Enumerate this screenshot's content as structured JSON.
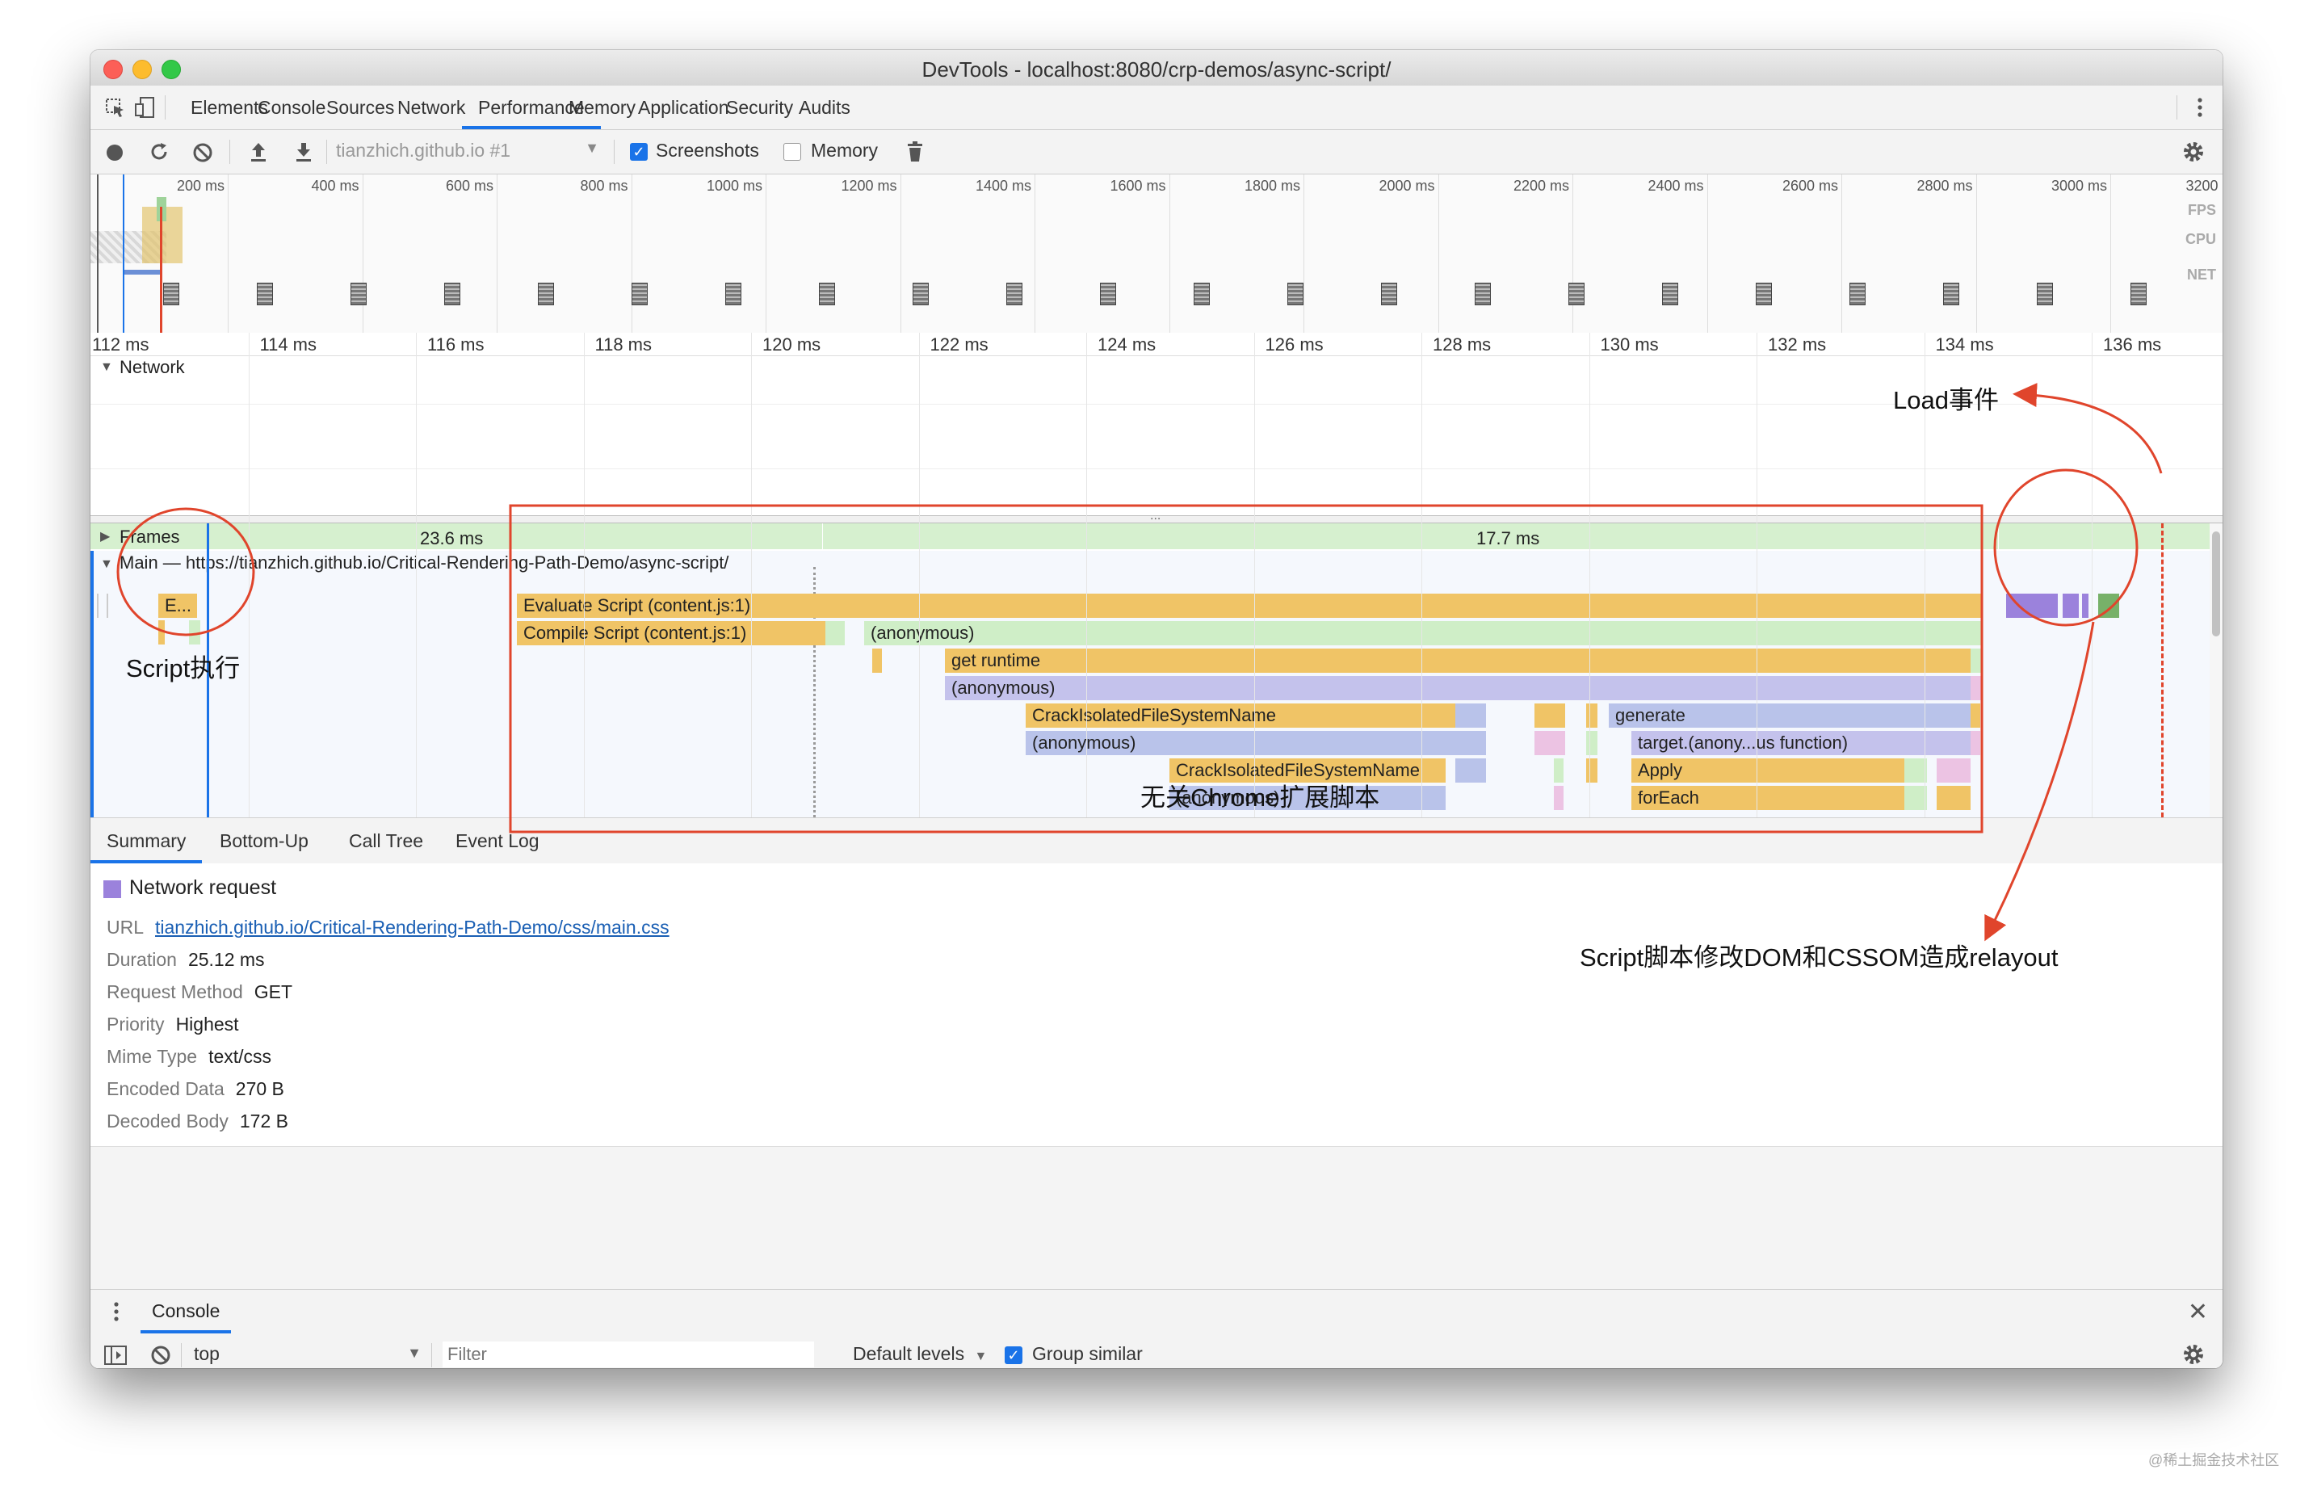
{
  "window": {
    "title": "DevTools - localhost:8080/crp-demos/async-script/"
  },
  "tabs": [
    "Elements",
    "Console",
    "Sources",
    "Network",
    "Performance",
    "Memory",
    "Application",
    "Security",
    "Audits"
  ],
  "active_tab": "Performance",
  "toolbar": {
    "profile_select": "tianzhich.github.io #1",
    "screenshots_label": "Screenshots",
    "screenshots_checked": true,
    "memory_label": "Memory",
    "memory_checked": false
  },
  "overview": {
    "ticks": [
      "200 ms",
      "400 ms",
      "600 ms",
      "800 ms",
      "1000 ms",
      "1200 ms",
      "1400 ms",
      "1600 ms",
      "1800 ms",
      "2000 ms",
      "2200 ms",
      "2400 ms",
      "2600 ms",
      "2800 ms",
      "3000 ms",
      "3200 ms"
    ],
    "labels": {
      "fps": "FPS",
      "cpu": "CPU",
      "net": "NET"
    }
  },
  "ruler": [
    "112 ms",
    "114 ms",
    "116 ms",
    "118 ms",
    "120 ms",
    "122 ms",
    "124 ms",
    "126 ms",
    "128 ms",
    "130 ms",
    "132 ms",
    "134 ms",
    "136 ms"
  ],
  "tracks": {
    "network": "Network",
    "frames": "Frames",
    "frame_durations": [
      "23.6 ms",
      "17.7 ms"
    ],
    "main": "Main — https://tianzhich.github.io/Critical-Rendering-Path-Demo/async-script/",
    "main_small": "E...",
    "flame": {
      "evaluate": "Evaluate Script (content.js:1)",
      "compile": "Compile Script (content.js:1)",
      "anon1": "(anonymous)",
      "get_runtime": "get runtime",
      "anon2": "(anonymous)",
      "crack1": "CrackIsolatedFileSystemName",
      "generate": "generate",
      "anon3": "(anonymous)",
      "target": "target.(anony...us function)",
      "crack2": "CrackIsolatedFileSystemName",
      "apply": "Apply",
      "anon4": "(anonymous)",
      "foreach": "forEach"
    }
  },
  "bottom_tabs": [
    "Summary",
    "Bottom-Up",
    "Call Tree",
    "Event Log"
  ],
  "active_bottom_tab": "Summary",
  "summary": {
    "heading": "Network request",
    "url_label": "URL",
    "url": "tianzhich.github.io/Critical-Rendering-Path-Demo/css/main.css",
    "duration_label": "Duration",
    "duration": "25.12 ms",
    "method_label": "Request Method",
    "method": "GET",
    "priority_label": "Priority",
    "priority": "Highest",
    "mime_label": "Mime Type",
    "mime": "text/css",
    "encoded_label": "Encoded Data",
    "encoded": "270 B",
    "decoded_label": "Decoded Body",
    "decoded": "172 B"
  },
  "console": {
    "tab": "Console",
    "context": "top",
    "filter_placeholder": "Filter",
    "levels": "Default levels",
    "group_similar": "Group similar",
    "prompt": "›"
  },
  "annotations": {
    "load_event": "Load事件",
    "script_exec": "Script执行",
    "unrelated": "无关Chrome扩展脚本",
    "relayout": "Script脚本修改DOM和CSSOM造成relayout"
  },
  "watermark": "@稀土掘金技术社区",
  "colors": {
    "annotation_red": "#e0452c",
    "script_yellow": "#f0c466",
    "script_light": "#cfeec7",
    "script_blue": "#b9c3ea",
    "focus_blue": "#1a73e8",
    "purple": "#9b82dc",
    "green": "#77b169"
  }
}
